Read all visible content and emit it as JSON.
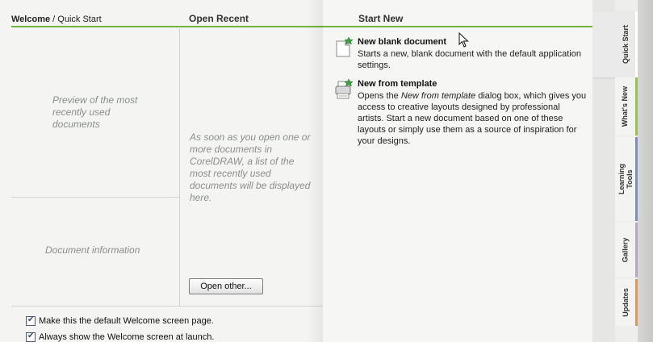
{
  "breadcrumb": {
    "current": "Welcome",
    "separator": " / ",
    "page": "Quick Start"
  },
  "open_recent": {
    "title": "Open Recent",
    "preview_placeholder": "Preview of the most recently used documents",
    "docinfo_placeholder": "Document information",
    "empty_message": "As soon as you open one or more documents in CorelDRAW, a list of the most recently used documents will be displayed here.",
    "open_other_label": "Open other..."
  },
  "options": {
    "default_welcome": "Make this the default Welcome screen page.",
    "always_show": "Always show the Welcome screen at launch."
  },
  "start_new": {
    "title": "Start New",
    "blank": {
      "title": "New blank document",
      "desc": "Starts a new, blank document with the default application settings."
    },
    "template": {
      "title": "New from template",
      "desc_pre": "Opens the ",
      "desc_em": "New from template",
      "desc_post": " dialog box, which gives you access to creative layouts designed by professional artists. Start a new document based on one of these layouts or simply use them as a source of inspiration for your designs."
    }
  },
  "tabs": {
    "quick_start": "Quick Start",
    "whats_new": "What's New",
    "learning_tools": "Learning Tools",
    "gallery": "Gallery",
    "updates": "Updates"
  },
  "colors": {
    "accent_green": "#6fb43b"
  }
}
